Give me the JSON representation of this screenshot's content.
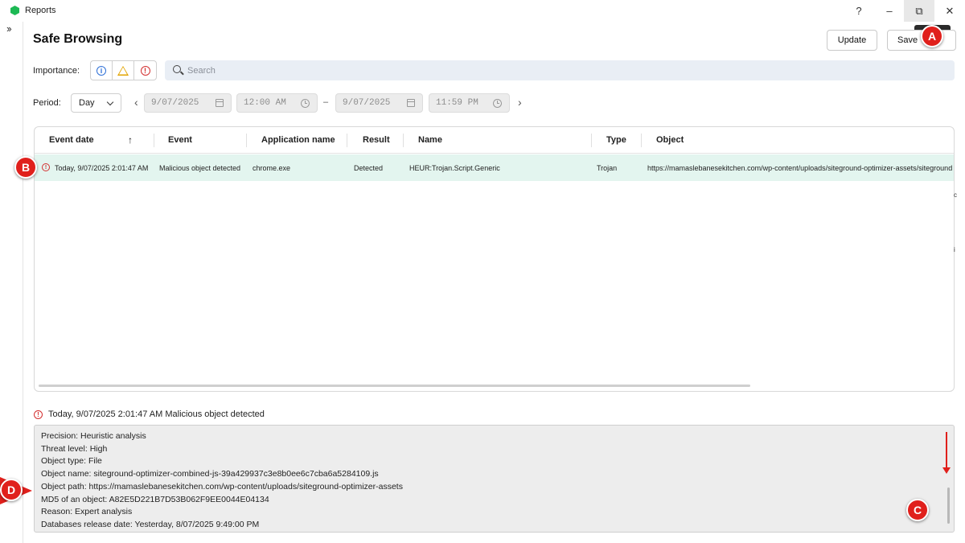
{
  "window": {
    "title": "Reports",
    "help_label": "?",
    "minimize_label": "–",
    "maximize_label": "⧉",
    "close_label": "✕"
  },
  "sidebar": {
    "expand_label": "››"
  },
  "page": {
    "title": "Safe Browsing",
    "update_label": "Update",
    "save_label": "Save"
  },
  "filters": {
    "importance_label": "Importance:",
    "search_placeholder": "Search",
    "period_label": "Period:",
    "period_value": "Day",
    "start_date": "9/07/2025",
    "start_time": "12:00 AM",
    "end_date": "9/07/2025",
    "end_time": "11:59 PM",
    "prev_label": "‹",
    "next_label": "›",
    "range_sep": "–"
  },
  "table": {
    "columns": [
      "Event date",
      "Event",
      "Application name",
      "Result",
      "Name",
      "Type",
      "Object"
    ],
    "sort_icon": "↑",
    "rows": [
      {
        "event_date": "Today, 9/07/2025 2:01:47 AM",
        "event": "Malicious object detected",
        "application": "chrome.exe",
        "result": "Detected",
        "name": "HEUR:Trojan.Script.Generic",
        "type": "Trojan",
        "object": "https://mamaslebanesekitchen.com/wp-content/uploads/siteground-optimizer-assets/siteground"
      }
    ]
  },
  "details": {
    "header": "Today, 9/07/2025 2:01:47 AM Malicious object detected",
    "lines": [
      "Precision: Heuristic analysis",
      "Threat level: High",
      "Object type: File",
      "Object name: siteground-optimizer-combined-js-39a429937c3e8b0ee6c7cba6a5284109.js",
      "Object path: https://mamaslebanesekitchen.com/wp-content/uploads/siteground-optimizer-assets",
      "MD5 of an object: A82E5D221B7D53B062F9EE0044E04134",
      "Reason: Expert analysis",
      "Databases release date: Yesterday, 8/07/2025 9:49:00 PM"
    ]
  },
  "annotations": {
    "a": "A",
    "b": "B",
    "c": "C",
    "d": "D"
  },
  "colors": {
    "accent_error": "#d32f2f",
    "accent_info": "#2d6fd6",
    "accent_warn": "#e2a400",
    "row_selected": "#e3f5ef",
    "annotation": "#e0201c"
  }
}
